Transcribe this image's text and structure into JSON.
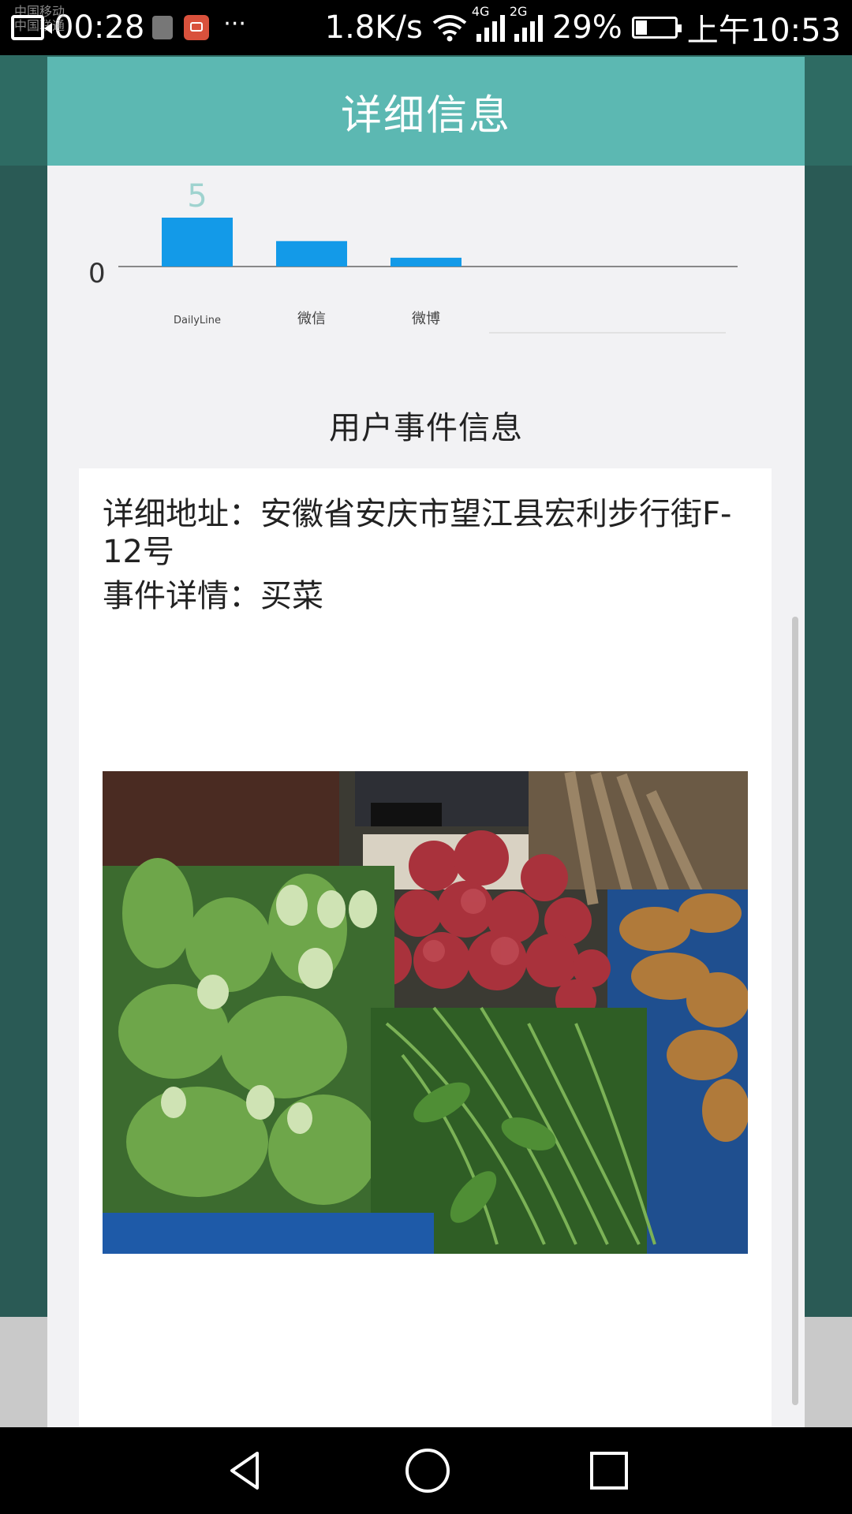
{
  "status_bar": {
    "carrier_lines": [
      "中国移动",
      "中国联通"
    ],
    "time": "00:28",
    "dots": "···",
    "net_speed": "1.8K/s",
    "sim1_tag": "4G",
    "sim2_tag": "2G",
    "battery": "29%",
    "clock": "上午10:53"
  },
  "dialog": {
    "title": "详细信息",
    "section_title": "用户事件信息",
    "address_label": "详细地址：",
    "address_value": "安徽省安庆市望江县宏利步行街F-12号",
    "event_label": "事件详情：",
    "event_value": "买菜",
    "photo_alt": "vegetables"
  },
  "chart_data": {
    "type": "bar",
    "categories": [
      "DailyLine",
      "微信",
      "微博"
    ],
    "values": [
      5,
      2.6,
      0.9
    ],
    "data_labels": [
      "5",
      "",
      ""
    ],
    "y_tick": "0",
    "color": "#139ae8"
  },
  "nav": {
    "back": "back-icon",
    "home": "home-icon",
    "recents": "recents-icon"
  }
}
